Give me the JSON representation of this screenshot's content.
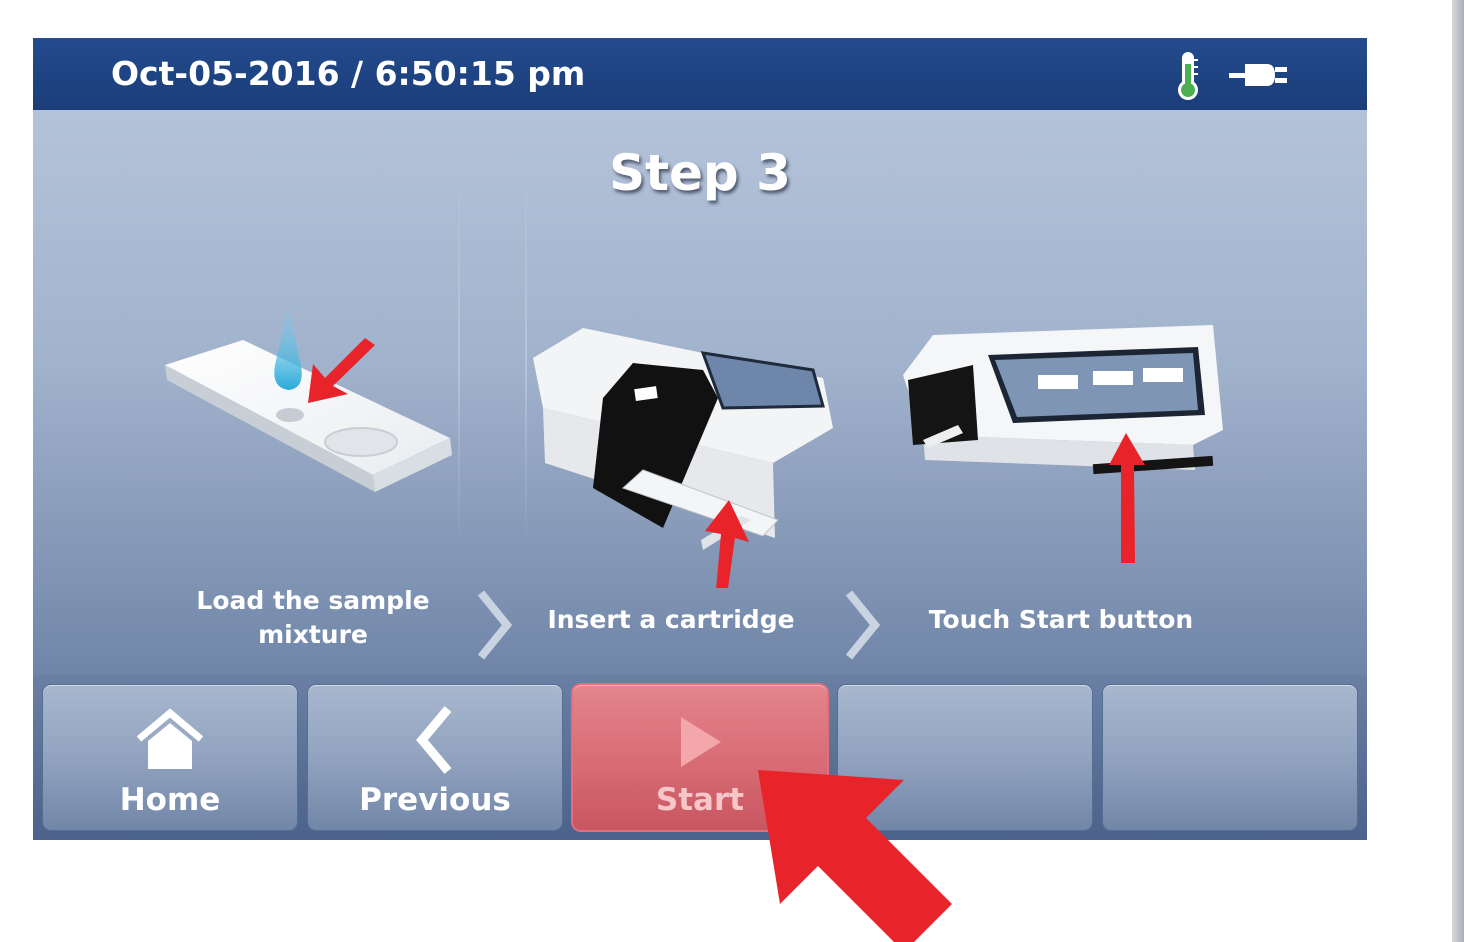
{
  "status_bar": {
    "datetime": "Oct-05-2016 / 6:50:15 pm",
    "icons": [
      "thermometer-icon",
      "power-plug-icon"
    ]
  },
  "main": {
    "title": "Step 3",
    "steps": [
      {
        "label": "Load the sample mixture",
        "illustration": "sample-cartridge-illustration"
      },
      {
        "label": "Insert a cartridge",
        "illustration": "insert-cartridge-illustration"
      },
      {
        "label": "Touch Start button",
        "illustration": "touch-start-illustration"
      }
    ]
  },
  "toolbar": {
    "home_label": "Home",
    "previous_label": "Previous",
    "start_label": "Start",
    "slots": [
      "Home",
      "Previous",
      "Start",
      "",
      ""
    ]
  },
  "colors": {
    "status_bar": "#1f4585",
    "toolbar_button": "#91a3bf",
    "start_button": "#d86b74",
    "arrow_red": "#e8232a",
    "sample_drop": "#3cb7de"
  }
}
